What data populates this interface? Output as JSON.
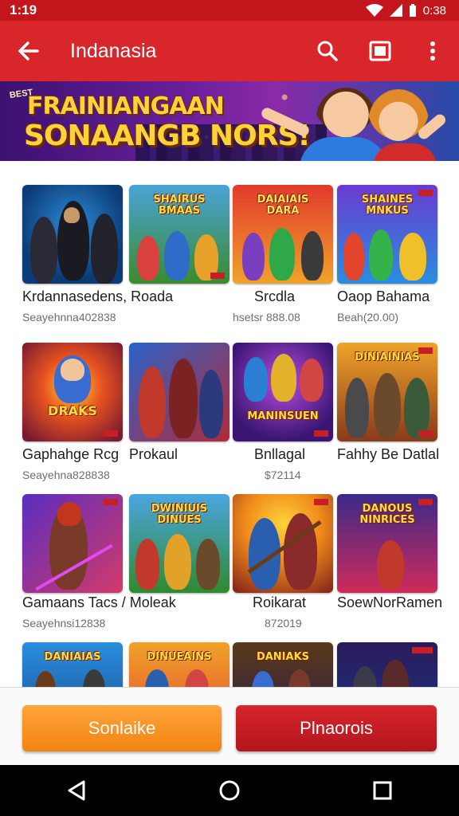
{
  "status_bar": {
    "time": "1:19",
    "right_time": "0:38"
  },
  "app_bar": {
    "title": "Indanasia"
  },
  "banner": {
    "kicker": "BEST",
    "line1": "FRAINIANGAAN",
    "line2": "SONAANGB NORS!"
  },
  "games": [
    {
      "title": "Krdannasedens, Roada",
      "subtitle": "Seayehnna402838",
      "logo": "",
      "tag_top": "",
      "tag_bottom": ""
    },
    {
      "title": "",
      "subtitle": "",
      "logo": "SHAIRUS BMAAS",
      "tag_top": "",
      "tag_bottom": ""
    },
    {
      "title": "Srcdla",
      "subtitle": "hsetsr 888.08",
      "logo": "DAIAIAIS DARA",
      "tag_top": "",
      "tag_bottom": ""
    },
    {
      "title": "Oaop Bahama",
      "subtitle": "Beah(20.00)",
      "logo": "SHAINES MNKUS",
      "tag_top": "",
      "tag_bottom": ""
    },
    {
      "title": "Gaphahge Rcg",
      "subtitle": "Seayehna828838",
      "logo": "DRAKS",
      "tag_top": "",
      "tag_bottom": ""
    },
    {
      "title": "Prokaul",
      "subtitle": "",
      "logo": "",
      "tag_top": "",
      "tag_bottom": ""
    },
    {
      "title": "Bnllagal",
      "subtitle": "$72114",
      "logo": "MANINSUEN",
      "tag_top": "",
      "tag_bottom": ""
    },
    {
      "title": "Fahhy Be Datlal",
      "subtitle": "",
      "logo": "DINIAINIAS",
      "tag_top": "",
      "tag_bottom": ""
    },
    {
      "title": "Gamaans Tacs / Moleak",
      "subtitle": "Seayehnsi12838",
      "logo": "",
      "tag_top": "",
      "tag_bottom": ""
    },
    {
      "title": "",
      "subtitle": "",
      "logo": "DWINIUIS DINUES",
      "tag_top": "",
      "tag_bottom": ""
    },
    {
      "title": "Roikarat",
      "subtitle": "872019",
      "logo": "",
      "tag_top": "",
      "tag_bottom": ""
    },
    {
      "title": "SoewNorRamen",
      "subtitle": "",
      "logo": "DANOUS NINRICES",
      "tag_top": "",
      "tag_bottom": ""
    },
    {
      "title": "",
      "subtitle": "",
      "logo": "DANIAIAS",
      "tag_top": "",
      "tag_bottom": ""
    },
    {
      "title": "",
      "subtitle": "",
      "logo": "DINUEAINS",
      "tag_top": "",
      "tag_bottom": ""
    },
    {
      "title": "",
      "subtitle": "",
      "logo": "DANIAKS",
      "tag_top": "",
      "tag_bottom": ""
    },
    {
      "title": "",
      "subtitle": "",
      "logo": "",
      "tag_top": "",
      "tag_bottom": ""
    }
  ],
  "buttons": {
    "primary": "Sonlaike",
    "secondary": "Plnaorois"
  },
  "colors": {
    "app_bar": "#d8262b",
    "status_bar": "#c3161c",
    "primary_button": "#f28412",
    "secondary_button": "#b3161c"
  },
  "icons": {
    "back": "arrow-left-icon",
    "search": "search-icon",
    "cast": "cast-icon",
    "menu": "more-vert-icon"
  }
}
